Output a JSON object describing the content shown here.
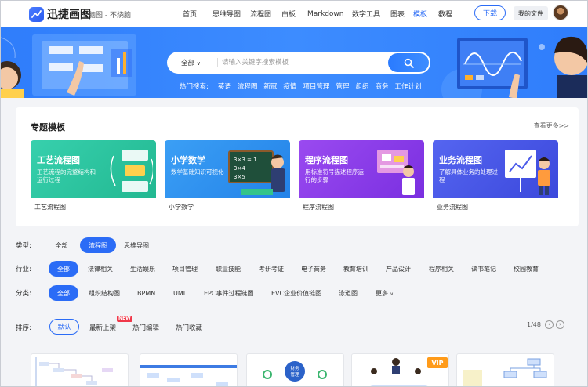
{
  "header": {
    "logo_text": "迅捷画图",
    "subtitle": "脑图 - 不烧脑",
    "nav": [
      "首页",
      "思维导图",
      "流程图",
      "白板",
      "Markdown",
      "数字工具",
      "图表",
      "模板",
      "教程"
    ],
    "active_nav": "模板",
    "download_label": "下载",
    "myfiles_label": "我的文件"
  },
  "banner": {
    "search_scope": "全部",
    "search_placeholder": "请输入关键字搜索模板",
    "hot_label": "热门搜索:",
    "hot_terms": [
      "英语",
      "流程图",
      "新冠",
      "疫情",
      "项目管理",
      "管理",
      "组织",
      "商务",
      "工作计划"
    ]
  },
  "featured": {
    "title": "专题模板",
    "more": "查看更多>>",
    "cards": [
      {
        "title": "工艺流程图",
        "desc": "工艺流程的完整结构和运行过程",
        "caption": "工艺流程图",
        "color": "#2ec4a0"
      },
      {
        "title": "小学数学",
        "desc": "数学基础知识可视化",
        "caption": "小学数学",
        "color": "#2f8df0"
      },
      {
        "title": "程序流程图",
        "desc": "用标准符号描述程序运行的步骤",
        "caption": "程序流程图",
        "color": "#8b3ee8"
      },
      {
        "title": "业务流程图",
        "desc": "了解具体业务的处理过程",
        "caption": "业务流程图",
        "color": "#4b5bea"
      }
    ]
  },
  "filters": {
    "type_label": "类型:",
    "types": [
      "全部",
      "流程图",
      "思维导图"
    ],
    "industry_label": "行业:",
    "industries": [
      "全部",
      "法律相关",
      "生活娱乐",
      "项目管理",
      "职业技能",
      "考研考证",
      "电子商务",
      "教育培训",
      "产品设计",
      "程序相关",
      "读书笔记",
      "校园教育"
    ],
    "category_label": "分类:",
    "categories": [
      "全部",
      "组织结构图",
      "BPMN",
      "UML",
      "EPC事件过程链图",
      "EVC企业价值链图",
      "泳道图",
      "更多"
    ]
  },
  "sort": {
    "label": "排序:",
    "options": [
      "默认",
      "最新上架",
      "热门编辑",
      "热门收藏"
    ],
    "new_badge": "NEW",
    "page": "1/48"
  },
  "thumbs": {
    "finance_text": "财务\n管理",
    "vip": "VIP"
  },
  "colors": {
    "accent": "#2b6cf6",
    "banner": "#3388fc"
  }
}
